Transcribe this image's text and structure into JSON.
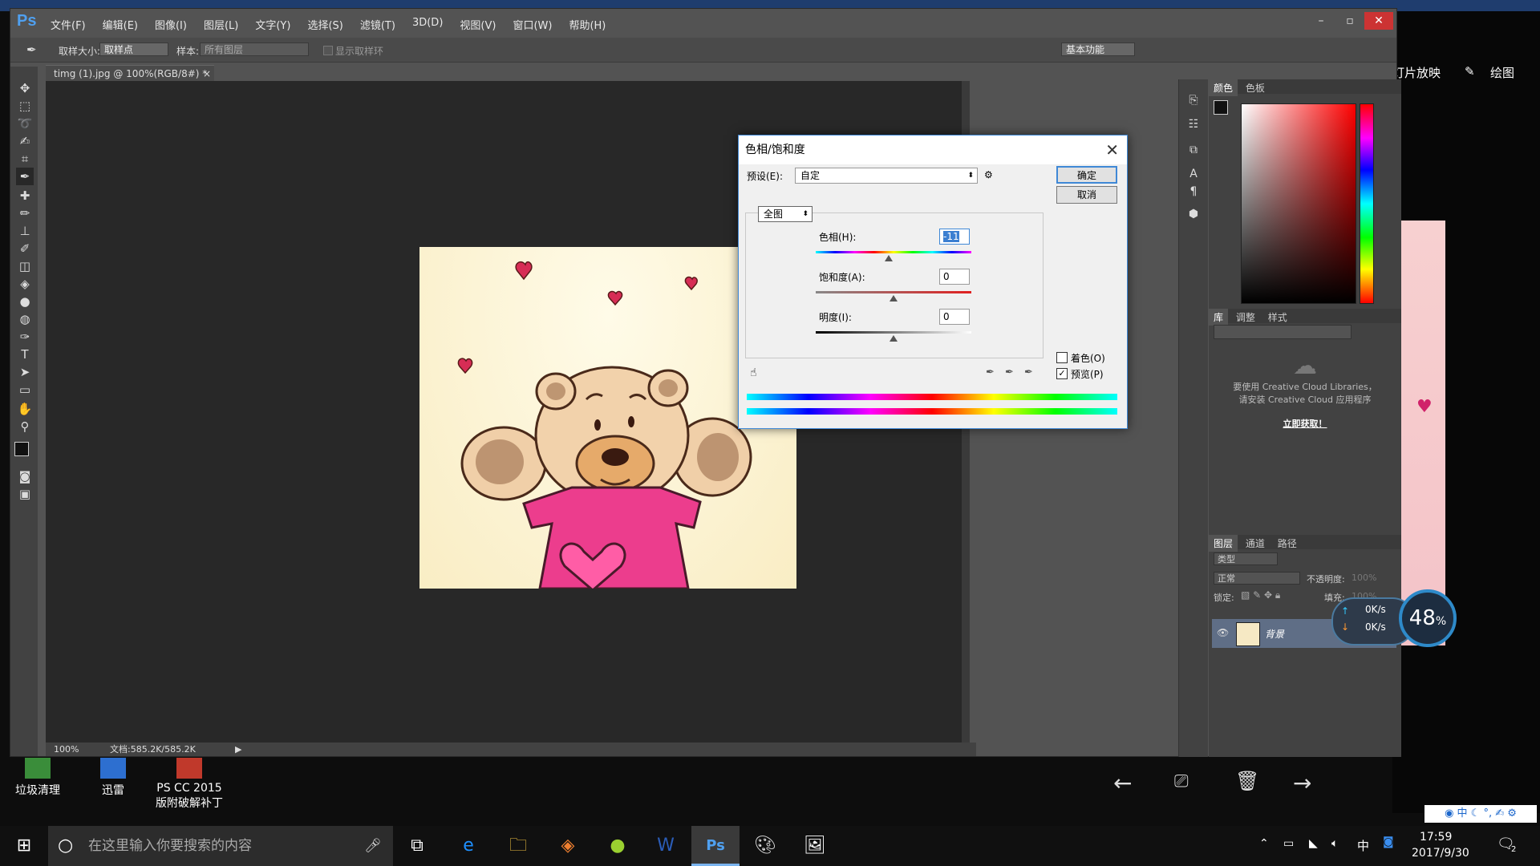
{
  "photoshop": {
    "logo": "Ps",
    "menu": [
      "文件(F)",
      "编辑(E)",
      "图像(I)",
      "图层(L)",
      "文字(Y)",
      "选择(S)",
      "滤镜(T)",
      "3D(D)",
      "视图(V)",
      "窗口(W)",
      "帮助(H)"
    ],
    "options": {
      "sample_size_label": "取样大小:",
      "sample_size_value": "取样点",
      "sample_label": "样本:",
      "sample_value": "所有图层",
      "show_ring_label": "显示取样环",
      "workspace": "基本功能"
    },
    "doc_tab": "timg (1).jpg @ 100%(RGB/8#) *",
    "doc_tab_close": "×",
    "status": {
      "zoom": "100%",
      "doc_size": "文档:585.2K/585.2K"
    },
    "color_tabs": [
      "颜色",
      "色板"
    ],
    "lib_tabs": [
      "库",
      "调整",
      "样式"
    ],
    "cc_message_1": "要使用 Creative Cloud Libraries，",
    "cc_message_2": "请安装 Creative Cloud 应用程序",
    "cc_link": "立即获取！",
    "layers_tabs": [
      "图层",
      "通道",
      "路径"
    ],
    "layer_filter": "类型",
    "blend_mode": "正常",
    "opacity_label": "不透明度:",
    "opacity_value": "100%",
    "lock_label": "锁定:",
    "fill_label": "填充:",
    "fill_value": "100%",
    "layer_name": "背景"
  },
  "dialog": {
    "title": "色相/饱和度",
    "preset_label": "预设(E):",
    "preset_value": "自定",
    "ok": "确定",
    "cancel": "取消",
    "channel": "全图",
    "hue_label": "色相(H):",
    "hue_value": "-11",
    "saturation_label": "饱和度(A):",
    "saturation_value": "0",
    "lightness_label": "明度(I):",
    "lightness_value": "0",
    "colorize_label": "着色(O)",
    "colorize_checked": false,
    "preview_label": "预览(P)",
    "preview_checked": true,
    "hue_slider_position": 0.45,
    "saturation_slider_position": 0.5,
    "lightness_slider_position": 0.5
  },
  "photo_viewer": {
    "slideshow": "灯片放映",
    "draw": "绘图"
  },
  "speed_widget": {
    "up": "0K/s",
    "down": "0K/s",
    "percent": "48",
    "percent_sign": "%"
  },
  "desktop_icons": [
    {
      "label": "垃圾清理"
    },
    {
      "label": "迅雷"
    },
    {
      "label_line1": "PS CC 2015",
      "label_line2": "版附破解补丁"
    }
  ],
  "taskbar": {
    "search_placeholder": "在这里输入你要搜索的内容",
    "time": "17:59",
    "date": "2017/9/30",
    "ime": "中",
    "notification_count": "2"
  },
  "colors": {
    "ps_blue": "#4fa0f0",
    "dialog_border": "#3f88d6",
    "shirt_pink": "#ec3d8d"
  }
}
